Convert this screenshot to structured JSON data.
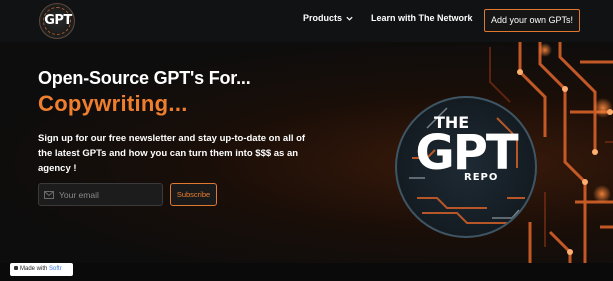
{
  "nav": {
    "logo_text": "GPT",
    "products_label": "Products",
    "network_label": "Learn with The Network",
    "cta_label": "Add your own GPTs!"
  },
  "hero": {
    "headline": "Open-Source GPT's For...",
    "sub_headline": "Copywriting...",
    "description": "Sign up for our free newsletter and stay up-to-date on all of the latest GPTs and how you can turn them into $$$ as an agency !",
    "email_placeholder": "Your email",
    "subscribe_label": "Subscribe"
  },
  "badge": {
    "the": "THE",
    "gpt": "GPT",
    "repo": "REPO"
  },
  "footer": {
    "made_with": "Made with",
    "brand": "Softr"
  },
  "colors": {
    "accent": "#ef7f2e",
    "nav_bg": "#111213",
    "page_bg": "#0d0d0d"
  },
  "icons": [
    "chevron-down-icon",
    "mail-icon",
    "softr-icon"
  ]
}
